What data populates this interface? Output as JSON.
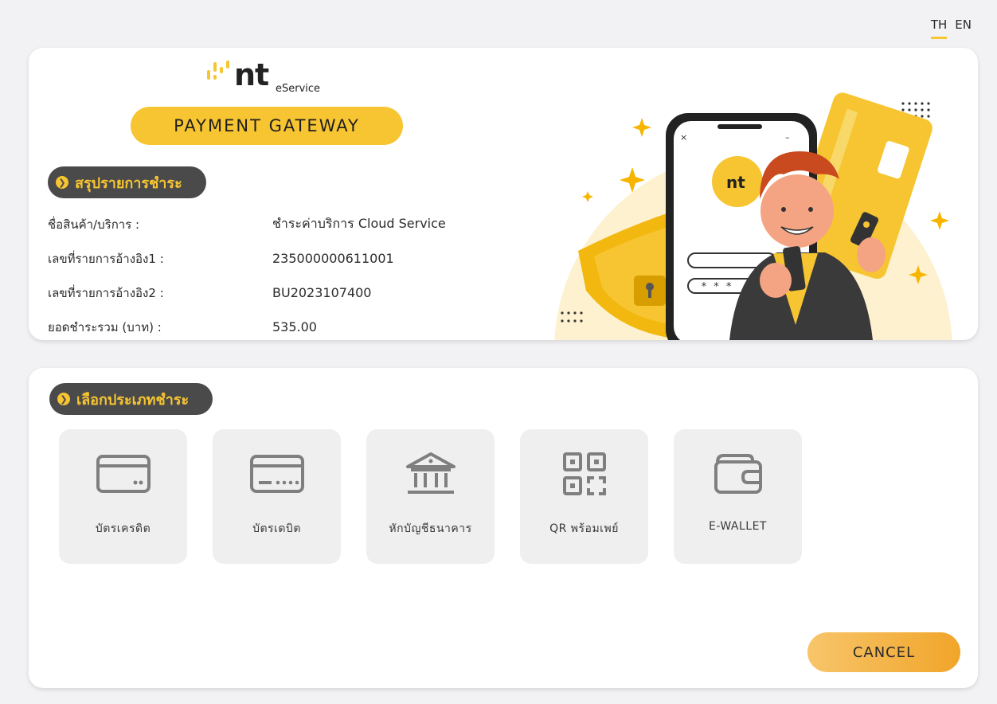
{
  "lang": {
    "th": "TH",
    "en": "EN"
  },
  "brand": {
    "logo_text": "nt",
    "logo_sub": "eService",
    "gateway_title": "PAYMENT GATEWAY"
  },
  "summary": {
    "heading": "สรุปรายการชำระ",
    "rows": [
      {
        "label": "ชื่อสินค้า/บริการ :",
        "value": "ชำระค่าบริการ Cloud Service"
      },
      {
        "label": "เลขที่รายการอ้างอิง1 :",
        "value": "235000000611001"
      },
      {
        "label": "เลขที่รายการอ้างอิง2 :",
        "value": "BU2023107400"
      },
      {
        "label": "ยอดชำระรวม (บาท) :",
        "value": "535.00"
      }
    ]
  },
  "illustration": {
    "phone_brand": "nt",
    "password_mask": "* * *",
    "close_glyph": "×",
    "minimize_glyph": "–"
  },
  "payment": {
    "heading": "เลือกประเภทชำระ",
    "methods": [
      {
        "label": "บัตรเครดิต",
        "icon": "credit-card-icon"
      },
      {
        "label": "บัตรเดบิต",
        "icon": "debit-card-icon"
      },
      {
        "label": "หักบัญชีธนาคาร",
        "icon": "bank-icon"
      },
      {
        "label": "QR พร้อมเพย์",
        "icon": "qr-code-icon"
      },
      {
        "label": "E-WALLET",
        "icon": "wallet-icon"
      }
    ]
  },
  "actions": {
    "cancel_label": "CANCEL"
  },
  "colors": {
    "accent": "#f7c531",
    "dark_pill": "#4a4a4a",
    "cancel_start": "#f7c56a",
    "cancel_end": "#f1a52a"
  }
}
